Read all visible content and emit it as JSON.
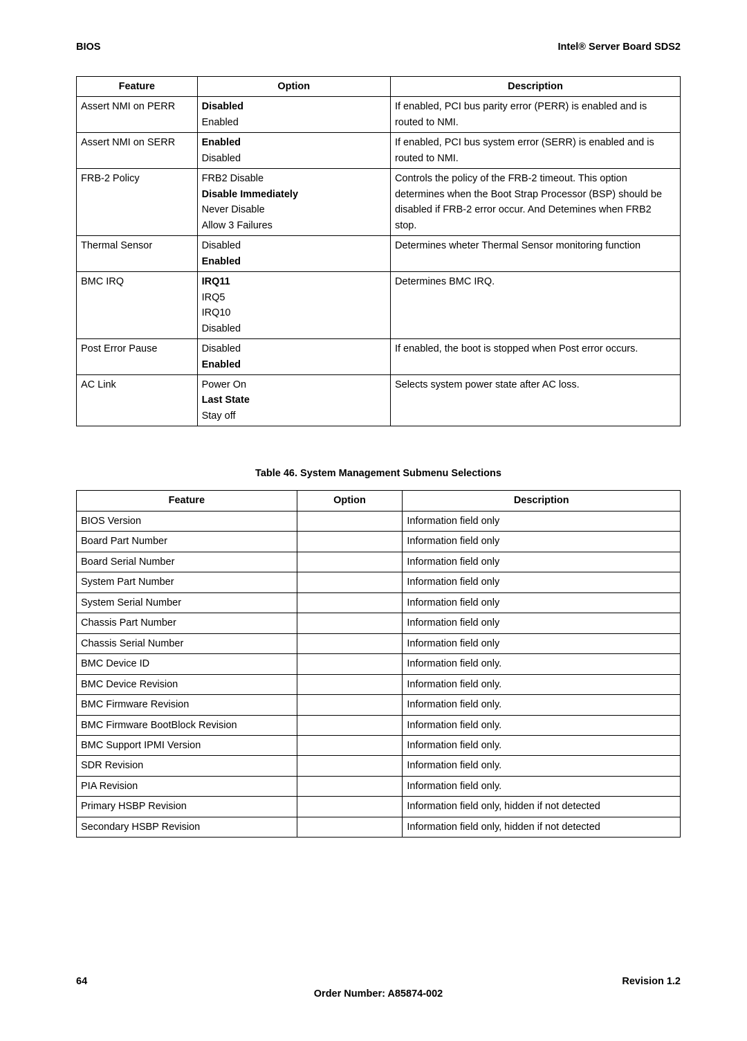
{
  "header": {
    "left": "BIOS",
    "right": "Intel® Server Board SDS2"
  },
  "table1": {
    "headers": {
      "feature": "Feature",
      "option": "Option",
      "description": "Description"
    },
    "rows": [
      {
        "feature": "Assert NMI on PERR",
        "options": [
          {
            "text": "Disabled",
            "default": true
          },
          {
            "text": "Enabled",
            "default": false
          }
        ],
        "description": "If enabled, PCI bus parity error (PERR) is enabled and is routed to NMI."
      },
      {
        "feature": "Assert NMI on SERR",
        "options": [
          {
            "text": "Enabled",
            "default": true
          },
          {
            "text": "Disabled",
            "default": false
          }
        ],
        "description": "If enabled, PCI bus system error (SERR) is enabled and is routed to NMI."
      },
      {
        "feature": "FRB-2 Policy",
        "options": [
          {
            "text": "FRB2 Disable",
            "default": false
          },
          {
            "text": "Disable Immediately",
            "default": true
          },
          {
            "text": "Never Disable",
            "default": false
          },
          {
            "text": "Allow 3 Failures",
            "default": false
          }
        ],
        "description": "Controls the policy of the FRB-2 timeout.  This option determines when the Boot Strap Processor (BSP) should be disabled if FRB-2 error occur. And Detemines when FRB2 stop."
      },
      {
        "feature": "Thermal Sensor",
        "options": [
          {
            "text": "Disabled",
            "default": false
          },
          {
            "text": "Enabled",
            "default": true
          }
        ],
        "description": "Determines wheter Thermal Sensor monitoring function"
      },
      {
        "feature": "BMC IRQ",
        "options": [
          {
            "text": "IRQ11",
            "default": true
          },
          {
            "text": "IRQ5",
            "default": false
          },
          {
            "text": "IRQ10",
            "default": false
          },
          {
            "text": "Disabled",
            "default": false
          }
        ],
        "description": "Determines BMC IRQ."
      },
      {
        "feature": "Post Error Pause",
        "options": [
          {
            "text": "Disabled",
            "default": false
          },
          {
            "text": "Enabled",
            "default": true
          }
        ],
        "description": "If enabled, the boot is stopped when Post error occurs."
      },
      {
        "feature": "AC Link",
        "options": [
          {
            "text": "Power On",
            "default": false
          },
          {
            "text": "Last State",
            "default": true
          },
          {
            "text": "Stay off",
            "default": false
          }
        ],
        "description": "Selects system power state after AC loss."
      }
    ]
  },
  "caption2": "Table 46. System Management Submenu Selections",
  "table2": {
    "headers": {
      "feature": "Feature",
      "option": "Option",
      "description": "Description"
    },
    "rows": [
      {
        "feature": "BIOS Version",
        "option": "",
        "description": "Information field only"
      },
      {
        "feature": "Board Part Number",
        "option": "",
        "description": "Information field only"
      },
      {
        "feature": "Board Serial Number",
        "option": "",
        "description": "Information field only"
      },
      {
        "feature": "System Part Number",
        "option": "",
        "description": "Information field only"
      },
      {
        "feature": "System Serial Number",
        "option": "",
        "description": "Information field only"
      },
      {
        "feature": "Chassis Part Number",
        "option": "",
        "description": "Information field only"
      },
      {
        "feature": "Chassis Serial Number",
        "option": "",
        "description": "Information field only"
      },
      {
        "feature": "BMC Device ID",
        "option": "",
        "description": "Information field only."
      },
      {
        "feature": "BMC Device Revision",
        "option": "",
        "description": "Information field only."
      },
      {
        "feature": "BMC Firmware Revision",
        "option": "",
        "description": "Information field only."
      },
      {
        "feature": "BMC Firmware BootBlock Revision",
        "option": "",
        "description": "Information field only."
      },
      {
        "feature": "BMC Support IPMI Version",
        "option": "",
        "description": "Information field only."
      },
      {
        "feature": "SDR Revision",
        "option": "",
        "description": "Information field only."
      },
      {
        "feature": "PIA Revision",
        "option": "",
        "description": "Information field only."
      },
      {
        "feature": "Primary HSBP Revision",
        "option": "",
        "description": "Information field only, hidden if not detected"
      },
      {
        "feature": "Secondary HSBP Revision",
        "option": "",
        "description": "Information field only, hidden if not detected"
      }
    ]
  },
  "footer": {
    "page": "64",
    "revision": "Revision 1.2",
    "order": "Order Number:  A85874-002"
  }
}
